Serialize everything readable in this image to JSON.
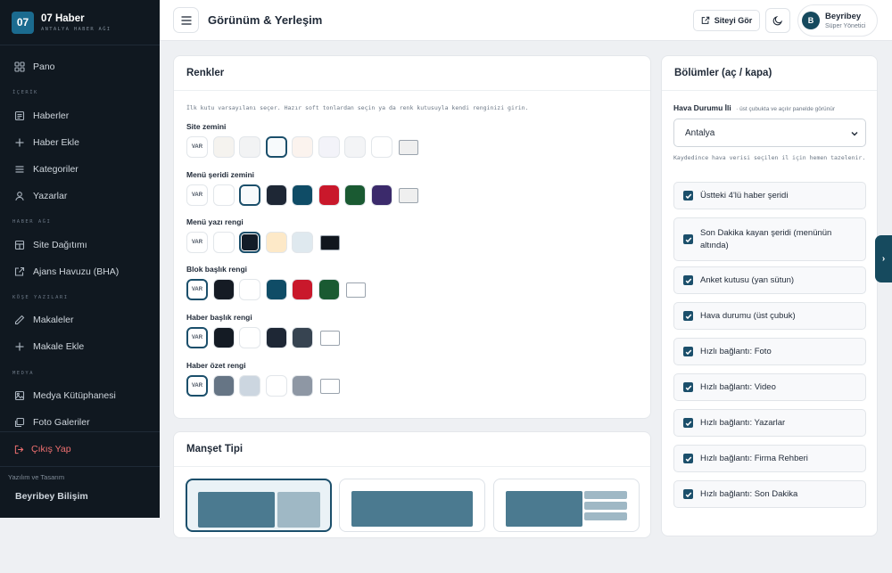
{
  "brand": {
    "logo": "07",
    "name": "07 Haber",
    "subtitle": "ANTALYA HABER AĞI"
  },
  "sidebar": {
    "items": [
      {
        "label": "Pano",
        "icon": "dashboard-icon"
      },
      {
        "label": "Haberler",
        "icon": "newspaper-icon"
      },
      {
        "label": "Haber Ekle",
        "icon": "plus-icon"
      },
      {
        "label": "Kategoriler",
        "icon": "list-icon"
      },
      {
        "label": "Yazarlar",
        "icon": "user-icon"
      },
      {
        "label": "Site Dağıtımı",
        "icon": "layout-icon"
      },
      {
        "label": "Ajans Havuzu (BHA)",
        "icon": "external-link-icon"
      },
      {
        "label": "Makaleler",
        "icon": "pen-icon"
      },
      {
        "label": "Makale Ekle",
        "icon": "plus-icon"
      },
      {
        "label": "Medya Kütüphanesi",
        "icon": "image-icon"
      },
      {
        "label": "Foto Galeriler",
        "icon": "gallery-icon"
      }
    ],
    "sections": [
      "İÇERİK",
      "HABER AĞI",
      "KÖŞE YAZILARI",
      "MEDYA"
    ],
    "logout": "Çıkış Yap",
    "credit_label": "Yazılım ve Tasarım",
    "credit_name": "Beyribey Bilişim"
  },
  "header": {
    "title": "Görünüm & Yerleşim",
    "site_button": "Siteyi Gör",
    "user_initial": "B",
    "user_name": "Beyribey",
    "user_role": "Süper Yönetici"
  },
  "colors_card": {
    "title": "Renkler",
    "hint": "İlk kutu varsayılanı seçer. Hazır soft tonlardan seçin ya da renk kutusuyla kendi renginizi girin.",
    "var_label": "VAR",
    "groups": [
      {
        "label": "Site zemini",
        "swatches": [
          "#f5f3ef",
          "#f2f3f4",
          "#f7fafc",
          "#fbf3ee",
          "#f3f3f9",
          "#f3f4f6",
          "#ffffff"
        ],
        "selected": 2,
        "picker": "#efefef",
        "var_selected": false
      },
      {
        "label": "Menü şeridi zemini",
        "swatches": [
          "#ffffff",
          "#f7fafc",
          "#1e2735",
          "#0f4c66",
          "#c9182b",
          "#1a5a32",
          "#3b2a6b"
        ],
        "selected": 1,
        "picker": "#efefef",
        "var_selected": false
      },
      {
        "label": "Menü yazı rengi",
        "swatches": [
          "#ffffff",
          "#121c28",
          "#fde9c8",
          "#dfe9ef"
        ],
        "selected": 1,
        "picker": "#10161e",
        "var_selected": false
      },
      {
        "label": "Blok başlık rengi",
        "swatches": [
          "#151b24",
          "#ffffff",
          "#0f4c66",
          "#c9182b",
          "#1a5a32"
        ],
        "selected": -1,
        "picker": "#ffffff",
        "var_selected": true
      },
      {
        "label": "Haber başlık rengi",
        "swatches": [
          "#141b24",
          "#ffffff",
          "#1e2735",
          "#374451"
        ],
        "selected": -1,
        "picker": "#ffffff",
        "var_selected": true
      },
      {
        "label": "Haber özet rengi",
        "swatches": [
          "#667585",
          "#ccd6e0",
          "#ffffff",
          "#8e97a4"
        ],
        "selected": -1,
        "picker": "#ffffff",
        "var_selected": true
      }
    ]
  },
  "manset_card": {
    "title": "Manşet Tipi"
  },
  "sections_card": {
    "title": "Bölümler (aç / kapa)",
    "weather_label": "Hava Durumu İli",
    "weather_note": "· üst çubukta ve açılır panelde görünür",
    "city": "Antalya",
    "city_hint": "Kaydedince hava verisi seçilen il için hemen tazelenir.",
    "toggles": [
      "Üstteki 4'lü haber şeridi",
      "Son Dakika kayan şeridi (menünün altında)",
      "Anket kutusu (yan sütun)",
      "Hava durumu (üst çubuk)",
      "Hızlı bağlantı: Foto",
      "Hızlı bağlantı: Video",
      "Hızlı bağlantı: Yazarlar",
      "Hızlı bağlantı: Firma Rehberi",
      "Hızlı bağlantı: Son Dakika"
    ]
  },
  "edge_tab": "›"
}
